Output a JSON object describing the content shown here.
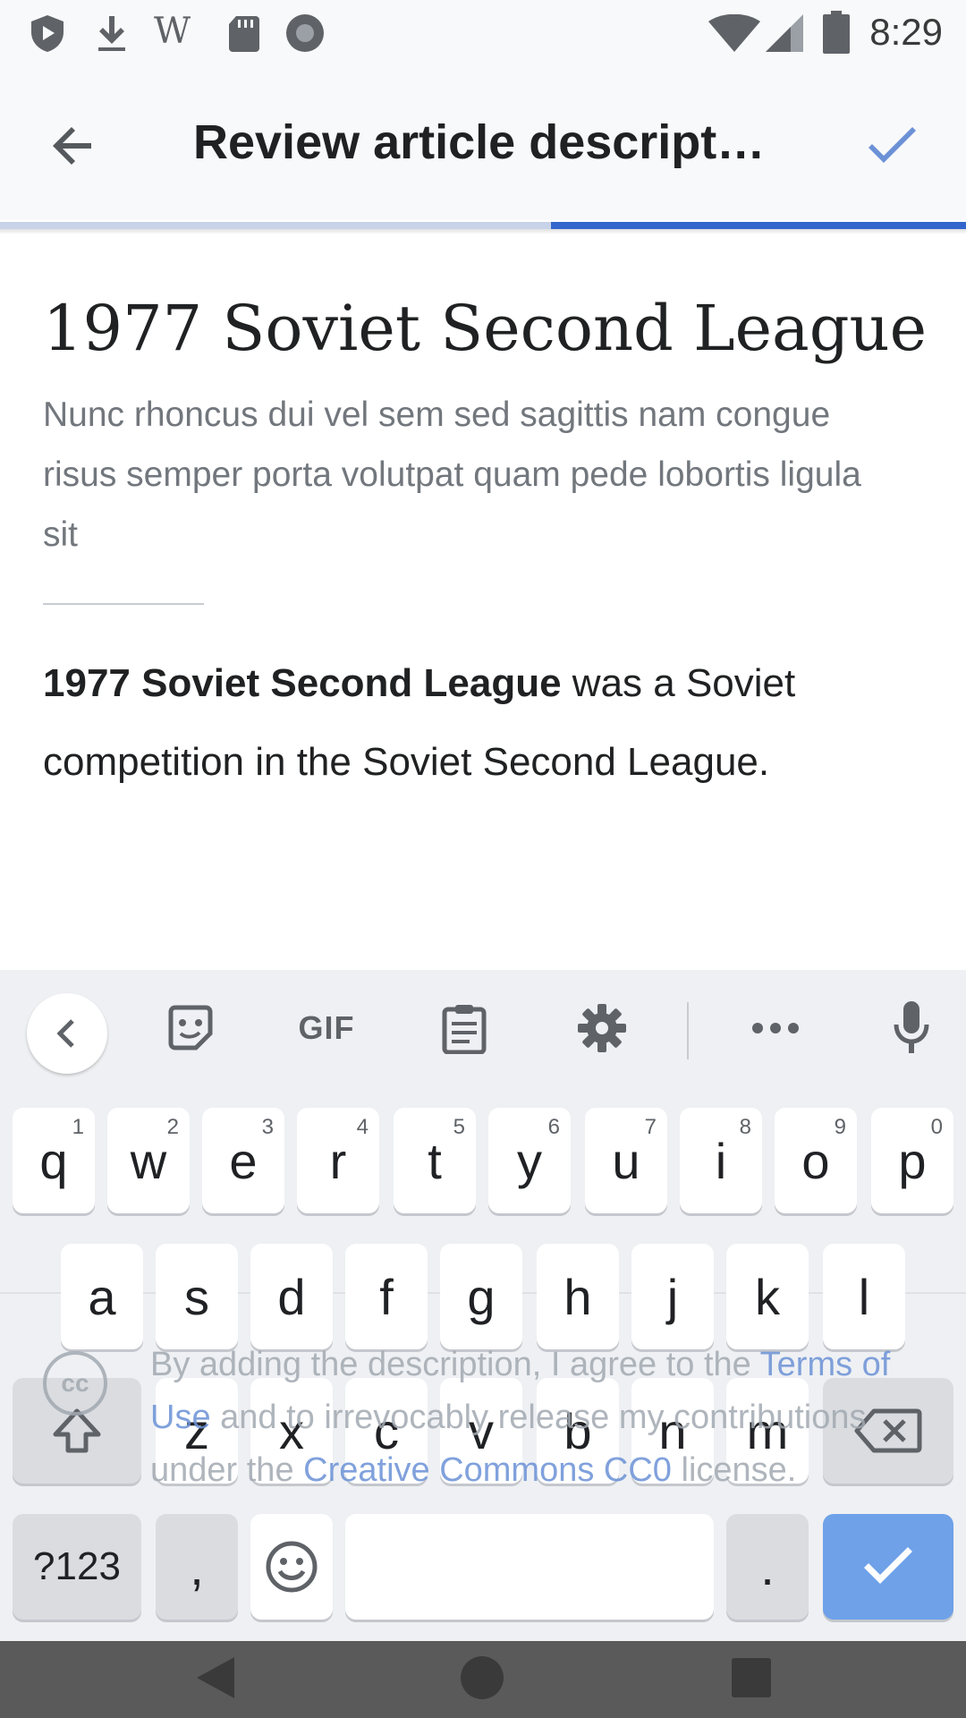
{
  "status_bar": {
    "time": "8:29",
    "left_icons": [
      "shield-play-icon",
      "download-icon",
      "wikipedia-icon",
      "sd-card-icon",
      "record-icon"
    ],
    "right_icons": [
      "wifi-icon",
      "cell-signal-icon",
      "battery-icon"
    ]
  },
  "app_bar": {
    "title": "Review article descript…",
    "progress": 0.57
  },
  "article": {
    "title": "1977 Soviet Second League",
    "description": "Nunc rhoncus dui vel sem sed sagittis nam congue risus semper porta volutpat quam pede lobortis ligula sit",
    "extract_bold": "1977 Soviet Second League",
    "extract_rest": " was a Soviet competition in the Soviet Second League."
  },
  "license": {
    "icon_text": "cc",
    "part1": "By adding the description, I agree to the ",
    "terms_link": "Terms of Use",
    "part2": " and to irrevocably release my contributions under the ",
    "cc_link": "Creative Commons CC0",
    "part3": " license."
  },
  "keyboard": {
    "toolbar": {
      "gif_label": "GIF",
      "icons": [
        "chevron-left-icon",
        "sticker-icon",
        "gif-icon",
        "clipboard-icon",
        "gear-icon",
        "more-icon",
        "mic-icon"
      ]
    },
    "row1": [
      {
        "key": "q",
        "hint": "1"
      },
      {
        "key": "w",
        "hint": "2"
      },
      {
        "key": "e",
        "hint": "3"
      },
      {
        "key": "r",
        "hint": "4"
      },
      {
        "key": "t",
        "hint": "5"
      },
      {
        "key": "y",
        "hint": "6"
      },
      {
        "key": "u",
        "hint": "7"
      },
      {
        "key": "i",
        "hint": "8"
      },
      {
        "key": "o",
        "hint": "9"
      },
      {
        "key": "p",
        "hint": "0"
      }
    ],
    "row2": [
      "a",
      "s",
      "d",
      "f",
      "g",
      "h",
      "j",
      "k",
      "l"
    ],
    "row3": [
      "z",
      "x",
      "c",
      "v",
      "b",
      "n",
      "m"
    ],
    "symbols_label": "?123",
    "comma": ",",
    "period": "."
  },
  "nav_bar": {
    "icons": [
      "back-triangle-icon",
      "home-circle-icon",
      "recents-square-icon"
    ]
  }
}
